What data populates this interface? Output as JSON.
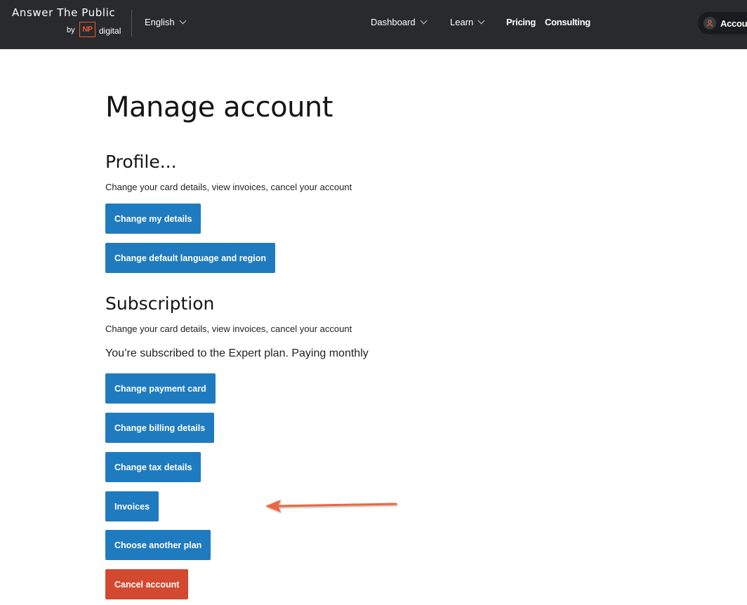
{
  "header": {
    "brand_name": "Answer The Public",
    "brand_by": "by",
    "brand_np": "NP",
    "brand_digital": "digital",
    "language": "English",
    "nav": {
      "dashboard": "Dashboard",
      "learn": "Learn",
      "pricing": "Pricing",
      "consulting": "Consulting"
    },
    "account_label": "Account"
  },
  "main": {
    "title": "Manage account",
    "profile": {
      "title": "Profile...",
      "description": "Change your card details, view invoices, cancel your account",
      "buttons": {
        "change_details": "Change my details",
        "change_language": "Change default language and region"
      }
    },
    "subscription": {
      "title": "Subscription",
      "description": "Change your card details, view invoices, cancel your account",
      "plan_text": "You’re subscribed to the Expert plan. Paying monthly",
      "buttons": {
        "change_payment": "Change payment card",
        "change_billing": "Change billing details",
        "change_tax": "Change tax details",
        "invoices": "Invoices",
        "choose_plan": "Choose another plan",
        "cancel": "Cancel account"
      }
    }
  },
  "colors": {
    "header_bg": "#282a2e",
    "primary_button": "#1f7bc0",
    "danger_button": "#d2492f",
    "annotation_arrow": "#e8673f",
    "brand_accent": "#e55a2b"
  },
  "icons": {
    "dropdown": "chevron-down-icon",
    "account": "user-icon",
    "annotation": "arrow-left-icon"
  }
}
